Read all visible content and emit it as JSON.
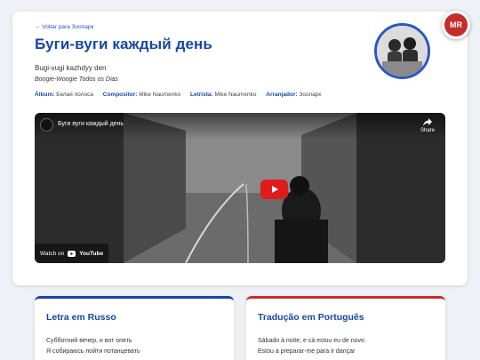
{
  "header": {
    "back_link": "← Voltar para Зоопарк",
    "title": "Буги-вуги каждый день",
    "transliteration": "Bugi-vugi kazhdyy den",
    "portuguese_title": "Boogie-Woogie Todos os Dias"
  },
  "meta": {
    "album_label": "Álbum:",
    "album_value": "Белая полоса",
    "composer_label": "Compositor:",
    "composer_value": "Mike Naumenko",
    "lyricist_label": "Letrista:",
    "lyricist_value": "Mike Naumenko",
    "arranger_label": "Arranjador:",
    "arranger_value": "Зоопарк"
  },
  "badge": {
    "text": "MR"
  },
  "video": {
    "title": "Буги вуги каждый день",
    "share_label": "Share",
    "watch_on": "Watch on",
    "youtube_label": "YouTube"
  },
  "lyrics_ru": {
    "heading": "Letra em Russo",
    "lines": [
      "Субботний вечер, и вот опять",
      "Я собираюсь пойти потанцевать"
    ]
  },
  "lyrics_pt": {
    "heading": "Tradução em Português",
    "lines": [
      "Sábado à noite, e cá estou eu de novo",
      "Estou a preparar-me para ir dançar"
    ]
  },
  "colors": {
    "accent_blue": "#1747a6",
    "accent_red": "#c42d2b",
    "play_red": "#e01b1b"
  }
}
